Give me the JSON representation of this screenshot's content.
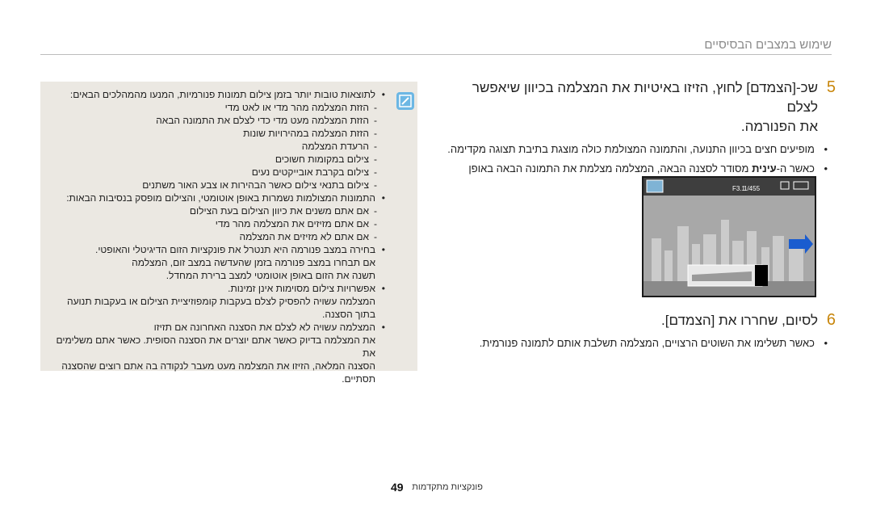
{
  "header": {
    "title": "שימוש במצבים הבסיסיים"
  },
  "step5": {
    "number": "5",
    "line1": "שכ-[הצמדם] לחוץ, הזיזו באיטיות את המצלמה בכיוון שיאפשר לצלם",
    "line2": "את הפנורמה.",
    "bullet1": "מופיעים חצים בכיוון התנועה, והתמונה המצולמת כולה מוצגת בתיבת תצוגה מקדימה.",
    "bullet2_pre": "כאשר ה-",
    "bullet2_bold": "עינית",
    "bullet2_post": " מסודר לסצנה הבאה, המצלמה מצלמת את התמונה הבאה באופן אוטומטי."
  },
  "screen": {
    "exposure": "F3.1",
    "shutter": "1/455",
    "bg_color": "#a8a8a8",
    "arrow_color": "#1a5ccf"
  },
  "step6": {
    "number": "6",
    "text": "לסיום, שחררו את [הצמדם].",
    "bullet": "כאשר תשלימו את השוטים הרצויים, המצלמה תשלבת אותם לתמונה פנורמית."
  },
  "note": {
    "items": [
      {
        "type": "b",
        "text": "לתוצאות טובות יותר בזמן צילום תמונות פנורמיות, המנעו מהמהלכים הבאים:"
      },
      {
        "type": "d",
        "text": "הזזת המצלמה מהר מדי או לאט מדי"
      },
      {
        "type": "d",
        "text": "הזזת המצלמה מעט מדי כדי לצלם את התמונה הבאה"
      },
      {
        "type": "d",
        "text": "הזזת המצלמה במהירויות שונות"
      },
      {
        "type": "d",
        "text": "הרעדת המצלמה"
      },
      {
        "type": "d",
        "text": "צילום במקומות חשוכים"
      },
      {
        "type": "d",
        "text": "צילום בקרבת אובייקטים נעים"
      },
      {
        "type": "d",
        "text": "צילום בתנאי צילום כאשר הבהירות או צבע האור משתנים"
      },
      {
        "type": "b",
        "text": "התמונות המצולמות נשמרות באופן אוטומטי, והצילום מופסק בנסיבות הבאות:"
      },
      {
        "type": "d",
        "text": "אם אתם משנים את כיוון הצילום בעת הצילום"
      },
      {
        "type": "d",
        "text": "אם אתם מזיזים את המצלמה מהר מדי"
      },
      {
        "type": "d",
        "text": "אם אתם לא מזיזים את המצלמה"
      },
      {
        "type": "b",
        "text": "בחירה במצב פנורמה היא תנטרל את פונקציות הזום הדיגיטלי והאופטי."
      },
      {
        "type": "c",
        "text": "אם תבחרו במצב פנורמה בזמן שהעדשה במצב זום, המצלמה"
      },
      {
        "type": "c",
        "text": "תשנה את הזום באופן אוטומטי למצב ברירת המחדל."
      },
      {
        "type": "b",
        "text": "אפשרויות צילום מסוימות אינן זמינות."
      },
      {
        "type": "c",
        "text": "המצלמה עשויה להפסיק לצלם בעקבות קומפוזיציית הצילום או בעקבות תנועה"
      },
      {
        "type": "c",
        "text": "בתוך הסצנה."
      },
      {
        "type": "b",
        "text": "המצלמה עשויה לא לצלם את הסצנה האחרונה אם תזיזו"
      },
      {
        "type": "c",
        "text": "את המצלמה בדיוק כאשר אתם יוצרים את הסצנה הסופית. כאשר אתם משלימים את"
      },
      {
        "type": "c",
        "text": "הסצנה המלאה, הזיזו את המצלמה מעט מעבר לנקודה בה אתם רוצים שהסצנה"
      },
      {
        "type": "c",
        "text": "תסתיים."
      }
    ]
  },
  "footer": {
    "section": "פונקציות מתקדמות",
    "page": "49"
  }
}
